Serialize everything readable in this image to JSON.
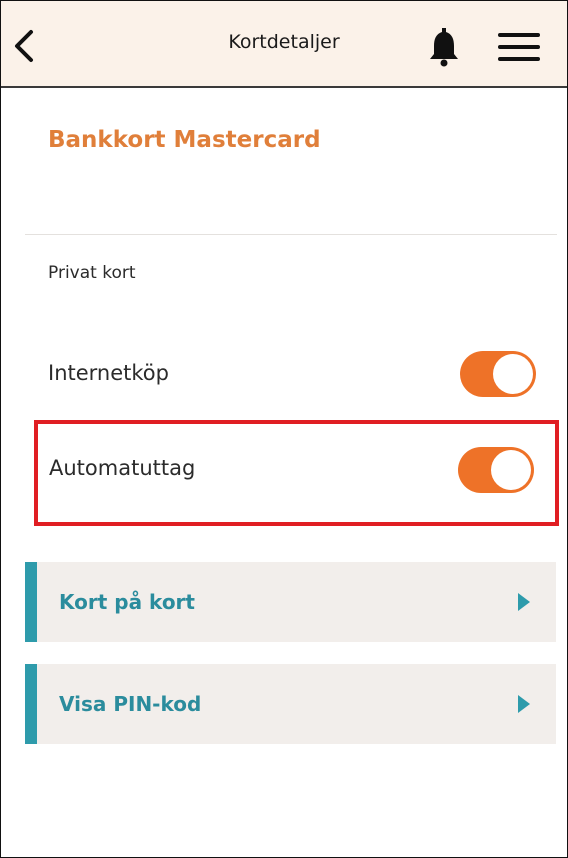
{
  "header": {
    "title": "Kortdetaljer",
    "back_icon": "chevron-left-icon",
    "bell_icon": "bell-icon",
    "menu_icon": "hamburger-menu-icon"
  },
  "card": {
    "title": "Bankkort Mastercard",
    "type": "Privat kort"
  },
  "settings": [
    {
      "label": "Internetköp",
      "enabled": true
    },
    {
      "label": "Automatuttag",
      "enabled": true
    }
  ],
  "links": [
    {
      "label": "Kort på kort",
      "icon": "chevron-right-icon"
    },
    {
      "label": "Visa PIN-kod",
      "icon": "chevron-right-icon"
    }
  ],
  "colors": {
    "header_bg": "#fbf2e9",
    "title_orange": "#e07f3a",
    "toggle_on": "#ee7228",
    "link_teal": "#2b8c9d",
    "highlight_red": "#e01e23"
  }
}
